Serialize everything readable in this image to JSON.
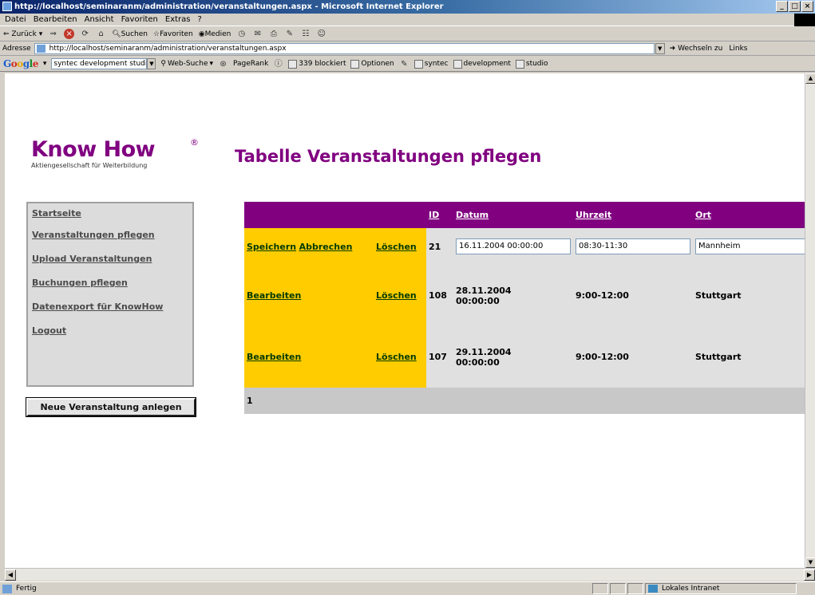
{
  "window": {
    "title": "http://localhost/seminaranm/administration/veranstaltungen.aspx - Microsoft Internet Explorer",
    "controls": [
      "_",
      "□",
      "×"
    ]
  },
  "menu": [
    "Datei",
    "Bearbeiten",
    "Ansicht",
    "Favoriten",
    "Extras",
    "?"
  ],
  "toolbar": {
    "back": "Zurück",
    "search": "Suchen",
    "favorites": "Favoriten",
    "media": "Medien"
  },
  "address": {
    "label": "Adresse",
    "url": "http://localhost/seminaranm/administration/veranstaltungen.aspx",
    "go": "Wechseln zu",
    "links": "Links"
  },
  "google_bar": {
    "logo": "Google",
    "query": "syntec development studio",
    "web_search": "Web-Suche",
    "pagerank": "PageRank",
    "blocked": "339 blockiert",
    "options": "Optionen",
    "links": [
      "syntec",
      "development",
      "studio"
    ]
  },
  "page": {
    "logo": {
      "brand": "Know How",
      "reg": "®",
      "subtitle": "Aktiengesellschaft für Weiterbildung"
    },
    "heading": "Tabelle Veranstaltungen pflegen",
    "nav": [
      "Startseite",
      "Veranstaltungen pflegen",
      "Upload Veranstaltungen",
      "Buchungen pflegen",
      "Datenexport für KnowHow",
      "Logout"
    ],
    "new_button": "Neue Veranstaltung anlegen",
    "table": {
      "headers": [
        "",
        "",
        "ID",
        "Datum",
        "Uhrzeit",
        "Ort"
      ],
      "edit_row": {
        "save": "Speichern",
        "cancel": "Abbrechen",
        "delete": "Löschen",
        "id": "21",
        "datum": "16.11.2004 00:00:00",
        "uhrzeit": "08:30-11:30",
        "ort": "Mannheim"
      },
      "rows": [
        {
          "edit": "Bearbeiten",
          "delete": "Löschen",
          "id": "108",
          "datum_line1": "28.11.2004",
          "datum_line2": "00:00:00",
          "uhrzeit": "9:00-12:00",
          "ort": "Stuttgart"
        },
        {
          "edit": "Bearbeiten",
          "delete": "Löschen",
          "id": "107",
          "datum_line1": "29.11.2004",
          "datum_line2": "00:00:00",
          "uhrzeit": "9:00-12:00",
          "ort": "Stuttgart"
        }
      ],
      "pager": "1"
    }
  },
  "status": {
    "text": "Fertig",
    "zone": "Lokales Intranet"
  }
}
